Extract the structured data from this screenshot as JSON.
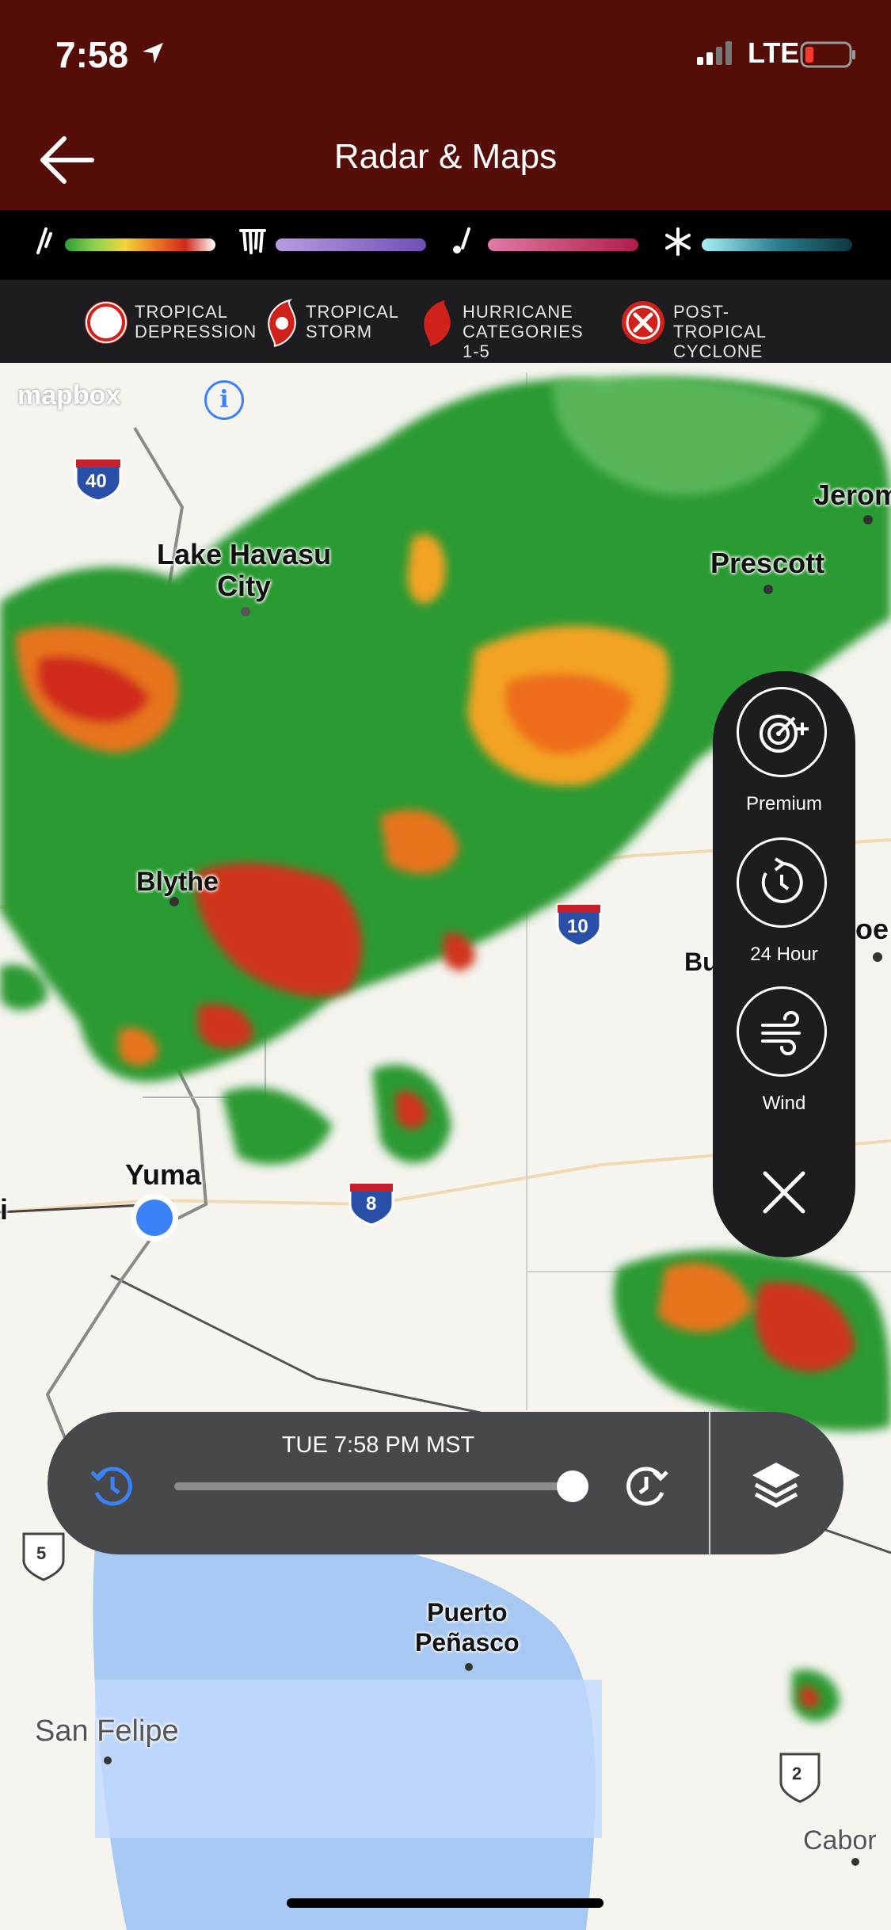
{
  "status_bar": {
    "time": "7:58",
    "carrier": "LTE"
  },
  "nav": {
    "title": "Radar & Maps"
  },
  "storm_legend": [
    {
      "label": "TROPICAL\nDEPRESSION",
      "icon": "tropical-depression-icon"
    },
    {
      "label": "TROPICAL\nSTORM",
      "icon": "tropical-storm-icon"
    },
    {
      "label": "HURRICANE\nCATEGORIES 1-5",
      "icon": "hurricane-icon"
    },
    {
      "label": "POST-TROPICAL\nCYCLONE",
      "icon": "post-tropical-cyclone-icon"
    }
  ],
  "map": {
    "attribution": "mapbox",
    "cities": [
      "Lake Havasu\nCity",
      "Prescott",
      "Jerom",
      "Blythe",
      "Bu",
      "oe",
      "Yuma",
      "i",
      "Puerto\nPeñasco",
      "San Felipe",
      "Cabor"
    ],
    "highway_shields": [
      "40",
      "10",
      "8",
      "5",
      "2"
    ]
  },
  "side_panel": {
    "premium_label": "Premium",
    "history_label": "24 Hour",
    "wind_label": "Wind"
  },
  "timeline": {
    "current_time": "TUE 7:58 PM MST",
    "progress": 1.0
  },
  "colors": {
    "header": "#550d08",
    "panel": "#1d1d1f",
    "timeline": "#46484c",
    "location_dot": "#3b82f6"
  }
}
